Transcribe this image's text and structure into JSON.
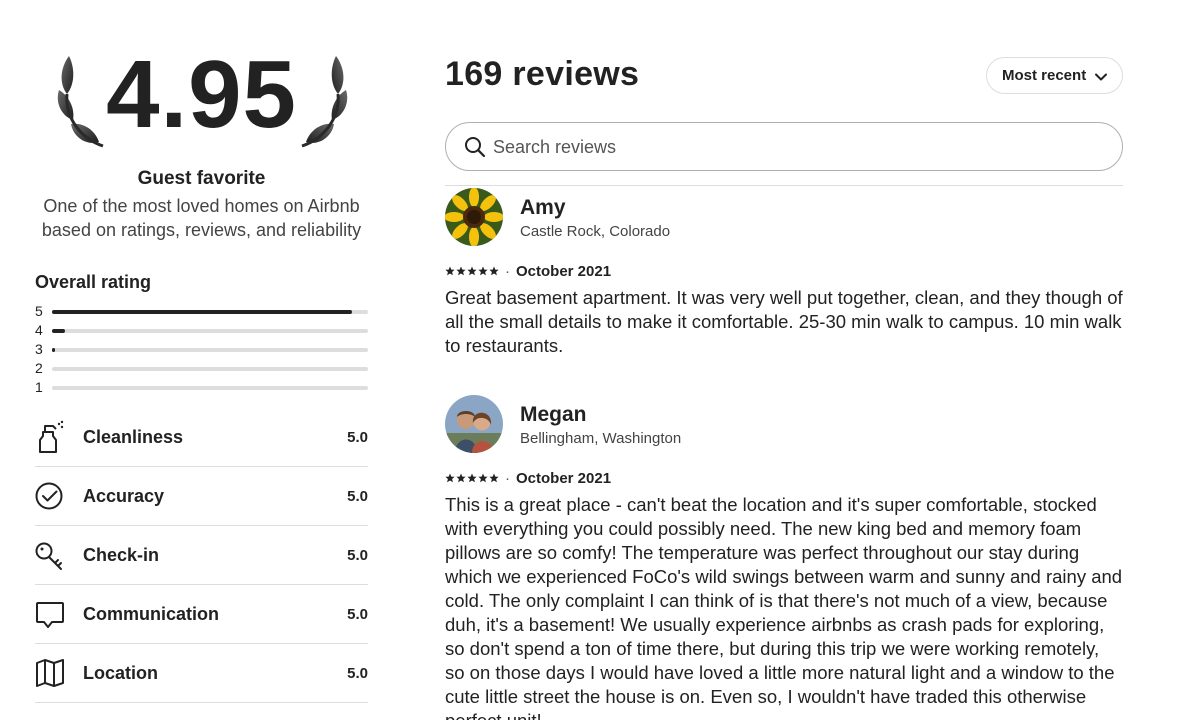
{
  "summary": {
    "rating": "4.95",
    "badge_title": "Guest favorite",
    "badge_desc_line1": "One of the most loved homes on Airbnb",
    "badge_desc_line2": "based on ratings, reviews, and reliability"
  },
  "overall": {
    "title": "Overall rating",
    "distribution": [
      {
        "stars": "5",
        "fraction": 0.95
      },
      {
        "stars": "4",
        "fraction": 0.04
      },
      {
        "stars": "3",
        "fraction": 0.01
      },
      {
        "stars": "2",
        "fraction": 0.0
      },
      {
        "stars": "1",
        "fraction": 0.0
      }
    ]
  },
  "categories": [
    {
      "name": "Cleanliness",
      "score": "5.0",
      "icon": "spray-bottle-icon"
    },
    {
      "name": "Accuracy",
      "score": "5.0",
      "icon": "check-circle-icon"
    },
    {
      "name": "Check-in",
      "score": "5.0",
      "icon": "key-icon"
    },
    {
      "name": "Communication",
      "score": "5.0",
      "icon": "chat-bubble-icon"
    },
    {
      "name": "Location",
      "score": "5.0",
      "icon": "map-icon"
    }
  ],
  "reviews_header": {
    "count_label": "169 reviews",
    "sort_label": "Most recent",
    "search_placeholder": "Search reviews"
  },
  "reviews": [
    {
      "name": "Amy",
      "location": "Castle Rock, Colorado",
      "rating": 5,
      "date": "October 2021",
      "text": "Great basement apartment. It was very well put together, clean, and they though of all the small details to make it comfortable. 25-30 min walk to campus. 10 min walk to restaurants."
    },
    {
      "name": "Megan",
      "location": "Bellingham, Washington",
      "rating": 5,
      "date": "October 2021",
      "text": "This is a great place - can't beat the location and it's super comfortable, stocked with everything you could possibly need. The new king bed and memory foam pillows are so comfy! The temperature was perfect throughout our stay during which we experienced FoCo's wild swings between warm and sunny and rainy and cold. The only complaint I can think of is that there's not much of a view, because duh, it's a basement! We usually experience airbnbs as crash pads for exploring, so don't spend a ton of time there, but during this trip we were working remotely, so on those days I would have loved a little more natural light and a window to the cute little street the house is on. Even so, I wouldn't have traded this otherwise perfect unit!"
    }
  ],
  "colors": {
    "text": "#222222",
    "muted": "#717171",
    "border": "#dddddd",
    "bar_track": "#dddddd",
    "bar_fill": "#222222"
  }
}
